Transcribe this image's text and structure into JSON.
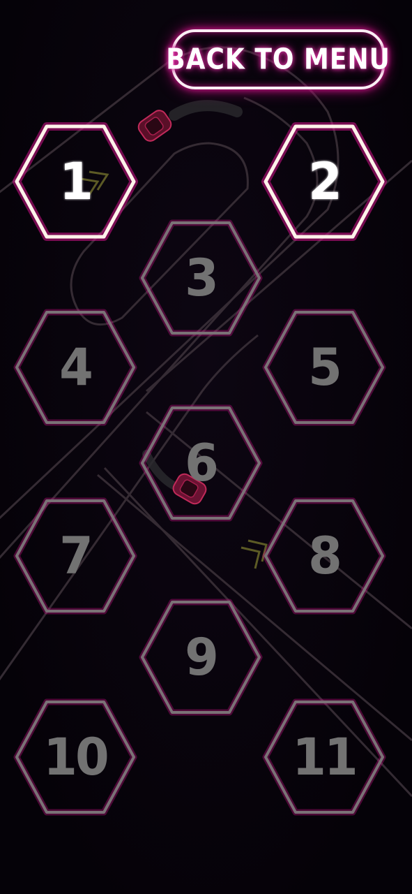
{
  "back_button": {
    "label": "BACK TO MENU"
  },
  "levels": [
    {
      "label": "1",
      "unlocked": true
    },
    {
      "label": "2",
      "unlocked": true
    },
    {
      "label": "3",
      "unlocked": false
    },
    {
      "label": "4",
      "unlocked": false
    },
    {
      "label": "5",
      "unlocked": false
    },
    {
      "label": "6",
      "unlocked": false
    },
    {
      "label": "7",
      "unlocked": false
    },
    {
      "label": "8",
      "unlocked": false
    },
    {
      "label": "9",
      "unlocked": false
    },
    {
      "label": "10",
      "unlocked": false
    },
    {
      "label": "11",
      "unlocked": false
    }
  ],
  "colors": {
    "background": "#07030b",
    "neon_glow": "#d4148c",
    "unlocked_outline": "#fff3ea",
    "locked_outline": "#7a7276",
    "locked_number": "#727272",
    "track": "#3a3038",
    "car": "#7a1434",
    "arrow": "#6b6a2a"
  },
  "icons": [
    "car-icon",
    "direction-arrow-icon"
  ]
}
